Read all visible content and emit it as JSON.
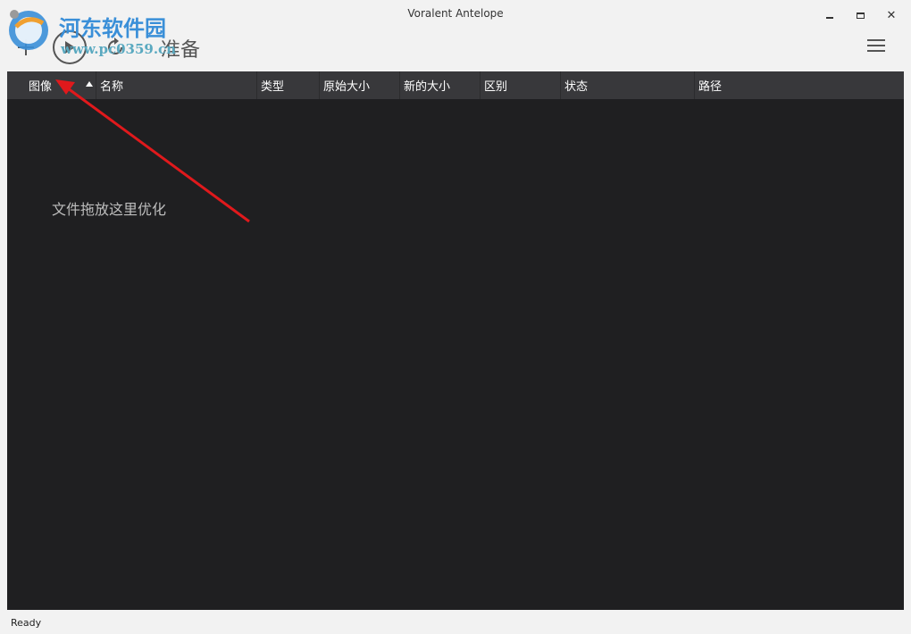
{
  "window": {
    "title": "Voralent Antelope",
    "controls": {
      "minimize": "minimize-icon",
      "maximize": "maximize-icon",
      "close": "✕"
    }
  },
  "watermark": {
    "site_name": "河东软件园",
    "site_url": "www.pc0359.cn"
  },
  "toolbar": {
    "add_icon": "add-icon",
    "play_icon": "play-icon",
    "refresh_icon": "refresh-icon",
    "status": "准备",
    "menu_icon": "hamburger-menu-icon"
  },
  "table": {
    "columns": [
      {
        "label": "图像"
      },
      {
        "label": "名称"
      },
      {
        "label": "类型"
      },
      {
        "label": "原始大小"
      },
      {
        "label": "新的大小"
      },
      {
        "label": "区别"
      },
      {
        "label": "状态"
      },
      {
        "label": "路径"
      }
    ],
    "sort_indicator": "ascending",
    "empty_hint": "文件拖放这里优化"
  },
  "statusbar": {
    "text": "Ready"
  },
  "colors": {
    "panel_bg": "#1f1f21",
    "header_bg": "#38383b",
    "annotation_arrow": "#e0191c",
    "watermark_blue": "#3a8fd8"
  }
}
